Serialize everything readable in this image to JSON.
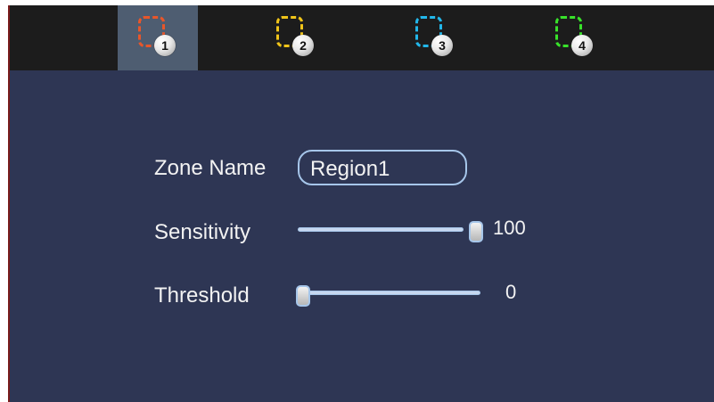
{
  "zones": [
    {
      "number": "1",
      "color": "#e8562a",
      "selected": true
    },
    {
      "number": "2",
      "color": "#f0c419",
      "selected": false
    },
    {
      "number": "3",
      "color": "#22b7ea",
      "selected": false
    },
    {
      "number": "4",
      "color": "#38e22a",
      "selected": false
    }
  ],
  "form": {
    "zone_name_label": "Zone Name",
    "zone_name_value": "Region1",
    "sensitivity_label": "Sensitivity",
    "sensitivity_value": "100",
    "sensitivity_level": 100,
    "threshold_label": "Threshold",
    "threshold_value": "0",
    "threshold_level": 0
  },
  "colors": {
    "panel": "#2e3654",
    "topbar": "#1c1c1c",
    "selected_tab": "#4e5d71",
    "accent": "#a6c6ea"
  }
}
